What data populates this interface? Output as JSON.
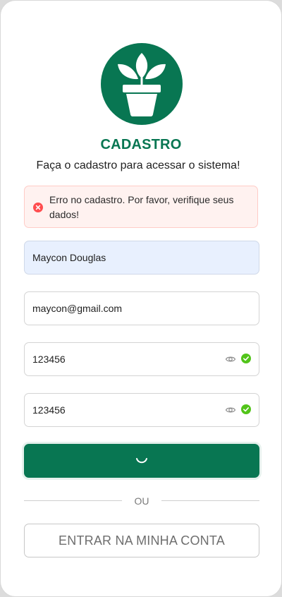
{
  "header": {
    "logo_icon": "plant-pot-icon",
    "title": "CADASTRO",
    "subtitle": "Faça o cadastro para acessar o sistema!"
  },
  "alert": {
    "icon": "error-circle-icon",
    "message": "Erro no cadastro. Por favor, verifique seus dados!"
  },
  "form": {
    "name_value": "Maycon Douglas",
    "email_value": "maycon@gmail.com",
    "password_value": "123456",
    "confirm_password_value": "123456",
    "submit_state": "loading"
  },
  "divider": {
    "label": "OU"
  },
  "login_button": {
    "label": "ENTRAR NA MINHA CONTA"
  },
  "colors": {
    "brand": "#087652",
    "error": "#ff4d4f",
    "success": "#52c41a",
    "autofill": "#e8f0fe"
  }
}
